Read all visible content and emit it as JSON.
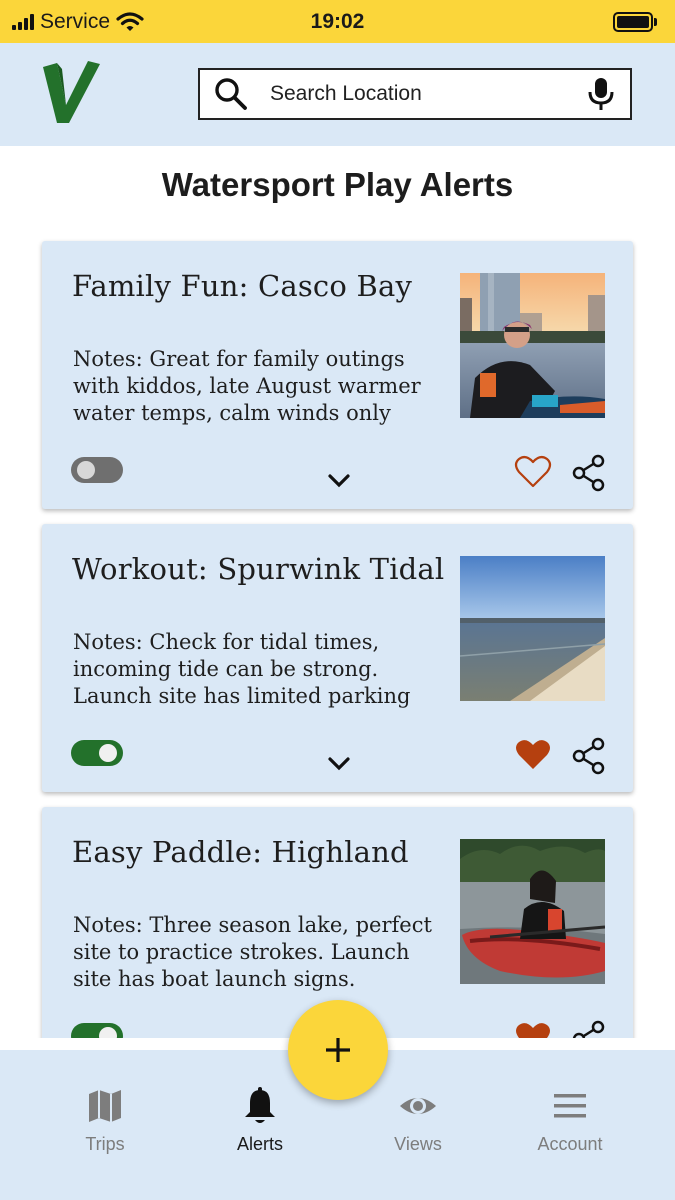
{
  "status_bar": {
    "carrier": "Service",
    "time": "19:02"
  },
  "search": {
    "placeholder": "Search Location"
  },
  "page_title": "Watersport Play Alerts",
  "alerts": [
    {
      "title": "Family Fun: Casco Bay",
      "notes": "Notes: Great for family outings with kiddos, late August warmer water temps, calm winds only",
      "enabled": false,
      "favorited": false
    },
    {
      "title": "Workout: Spurwink Tidal",
      "notes": "Notes: Check for tidal times, incoming tide can be strong. Launch site has limited parking",
      "enabled": true,
      "favorited": true
    },
    {
      "title": "Easy Paddle: Highland",
      "notes": "Notes: Three season lake, perfect site to practice strokes. Launch site has boat launch signs.",
      "enabled": true,
      "favorited": true
    }
  ],
  "nav": {
    "items": [
      {
        "label": "Trips",
        "icon": "map-icon"
      },
      {
        "label": "Alerts",
        "icon": "bell-icon",
        "active": true
      },
      {
        "label": "Views",
        "icon": "eye-icon"
      },
      {
        "label": "Account",
        "icon": "menu-icon"
      }
    ]
  },
  "colors": {
    "status_bar": "#fbd63a",
    "header_bg": "#dae8f6",
    "card_bg": "#dae8f6",
    "logo_green": "#23712b",
    "toggle_on": "#23712b",
    "toggle_off": "#6f6f6f",
    "heart": "#b5400f",
    "fab": "#fbd63a"
  }
}
